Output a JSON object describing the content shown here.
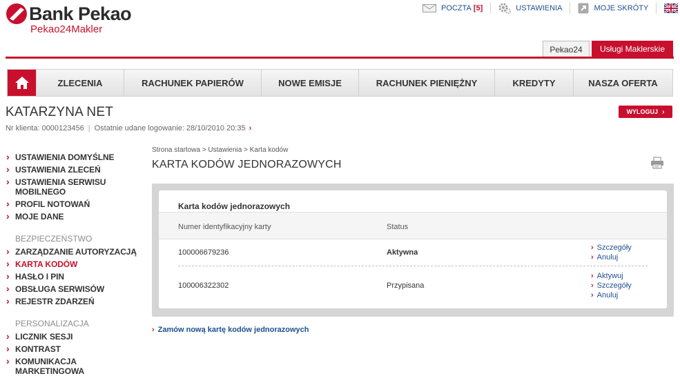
{
  "brand": {
    "name": "Bank Pekao",
    "sub": "Pekao24Makler",
    "accent": "#c8102e",
    "link_color": "#1d4f91"
  },
  "topnav": {
    "mail_label": "POCZTA",
    "mail_count": "[5]",
    "settings_label": "USTAWIENIA",
    "shortcuts_label": "MOJE SKRÓTY",
    "language_icon": "uk-flag-icon"
  },
  "channel_tabs": {
    "pekao24": "Pekao24",
    "brokerage": "Usługi Maklerskie"
  },
  "mainnav": {
    "home_icon": "home-icon",
    "items": [
      "ZLECENIA",
      "RACHUNEK PAPIERÓW",
      "NOWE EMISJE",
      "RACHUNEK PIENIĘŻNY",
      "KREDYTY",
      "NASZA OFERTA"
    ]
  },
  "user": {
    "name": "KATARZYNA NET",
    "client_no": "Nr klienta: 0000123456",
    "last_login": "Ostatnie udane logowanie: 28/10/2010 20:35",
    "logout_label": "WYLOGUJ"
  },
  "sidebar": {
    "settings_items": [
      "USTAWIENIA DOMYŚLNE",
      "USTAWIENIA ZLECEŃ",
      "USTAWIENIA SERWISU MOBILNEGO",
      "PROFIL NOTOWAŃ",
      "MOJE DANE"
    ],
    "security_header": "BEZPIECZEŃSTWO",
    "security_items": [
      "ZARZĄDZANIE AUTORYZACJĄ",
      "KARTA KODÓW",
      "HASŁO I PIN",
      "OBSŁUGA SERWISÓW",
      "REJESTR ZDARZEŃ"
    ],
    "personalization_header": "PERSONALIZACJA",
    "personalization_items": [
      "LICZNIK SESJI",
      "KONTRAST",
      "KOMUNIKACJA MARKETINGOWA"
    ],
    "active": "KARTA KODÓW"
  },
  "main": {
    "breadcrumb": "Strona startowa > Ustawienia > Karta kodów",
    "title": "KARTA KODÓW JEDNORAZOWYCH",
    "print_icon": "printer-icon",
    "card": {
      "title": "Karta kodów jednorazowych",
      "columns": [
        "Numer identyfikacyjny karty",
        "Status"
      ],
      "rows": [
        {
          "number": "100006679236",
          "status": "Aktywna",
          "actions": [
            "Szczegóły",
            "Anuluj"
          ]
        },
        {
          "number": "100006322302",
          "status": "Przypisana",
          "actions": [
            "Aktywuj",
            "Szczegóły",
            "Anuluj"
          ]
        }
      ]
    },
    "order_link": "Zamów nową kartę kodów jednorazowych"
  }
}
